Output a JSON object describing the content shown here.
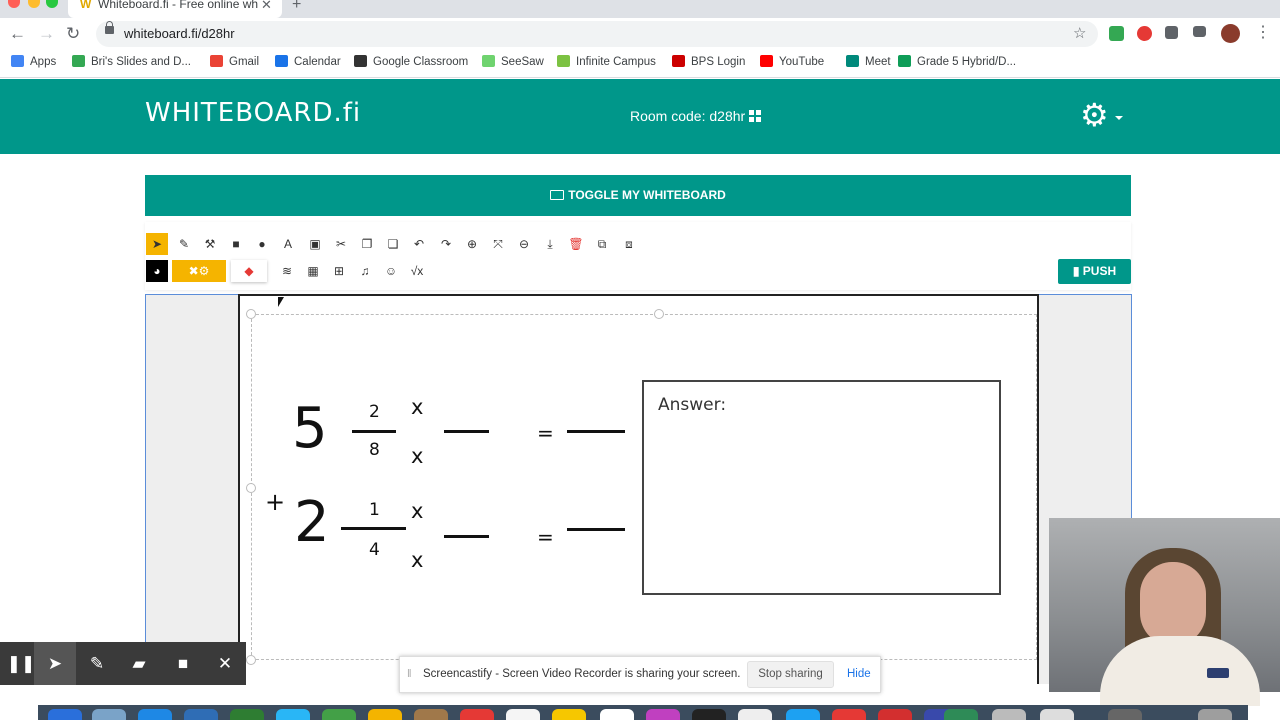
{
  "browser": {
    "tab_title": "Whiteboard.fi - Free online wh",
    "tab_favicon": "W",
    "close_glyph": "✕",
    "new_tab_glyph": "+",
    "back_glyph": "←",
    "forward_glyph": "→",
    "reload_glyph": "↻",
    "url": "whiteboard.fi/d28hr",
    "star_glyph": "☆",
    "menu_glyph": "⋮",
    "bookmarks": [
      {
        "label": "Apps",
        "icon": "apps-grid-icon",
        "color": "#4285f4"
      },
      {
        "label": "Bri's Slides and D...",
        "icon": "google-drive-icon",
        "color": "#34a853"
      },
      {
        "label": "Gmail",
        "icon": "gmail-icon",
        "color": "#ea4335"
      },
      {
        "label": "Calendar",
        "icon": "calendar-icon",
        "color": "#1a73e8"
      },
      {
        "label": "Google Classroom",
        "icon": "classroom-icon",
        "color": "#333333"
      },
      {
        "label": "SeeSaw",
        "icon": "seesaw-icon",
        "color": "#6fd36f"
      },
      {
        "label": "Infinite Campus",
        "icon": "infinite-campus-icon",
        "color": "#7cc242"
      },
      {
        "label": "BPS Login",
        "icon": "bps-icon",
        "color": "#cc0000"
      },
      {
        "label": "YouTube",
        "icon": "youtube-icon",
        "color": "#ff0000"
      },
      {
        "label": "Meet",
        "icon": "meet-icon",
        "color": "#00897b"
      },
      {
        "label": "Grade 5 Hybrid/D...",
        "icon": "sheets-icon",
        "color": "#0f9d58"
      }
    ]
  },
  "app": {
    "logo": "WHITEBOARD.fi",
    "room_code": "Room code: d28hr",
    "gear_glyph": "⚙",
    "toggle_label": "TOGGLE MY WHITEBOARD",
    "push_label": "PUSH",
    "accent_color": "#00978a",
    "highlight_color": "#f5b400"
  },
  "tools": {
    "row1": [
      {
        "icon": "select-arrow-icon",
        "glyph": "➤"
      },
      {
        "icon": "pencil-icon",
        "glyph": "✎"
      },
      {
        "icon": "magic-wand-icon",
        "glyph": "⚒"
      },
      {
        "icon": "rectangle-icon",
        "glyph": "■"
      },
      {
        "icon": "circle-icon",
        "glyph": "●"
      },
      {
        "icon": "text-icon",
        "glyph": "A"
      },
      {
        "icon": "image-icon",
        "glyph": "▣"
      },
      {
        "icon": "cut-icon",
        "glyph": "✂"
      },
      {
        "icon": "copy-icon",
        "glyph": "❐"
      },
      {
        "icon": "paste-icon",
        "glyph": "❏"
      },
      {
        "icon": "undo-icon",
        "glyph": "↶"
      },
      {
        "icon": "redo-icon",
        "glyph": "↷"
      },
      {
        "icon": "zoom-in-icon",
        "glyph": "⊕"
      },
      {
        "icon": "fit-screen-icon",
        "glyph": "⤧"
      },
      {
        "icon": "zoom-out-icon",
        "glyph": "⊖"
      },
      {
        "icon": "download-icon",
        "glyph": "⤓"
      },
      {
        "icon": "delete-icon",
        "glyph": "🗑"
      },
      {
        "icon": "bring-front-icon",
        "glyph": "⧉"
      },
      {
        "icon": "send-back-icon",
        "glyph": "⧈"
      }
    ],
    "row2": [
      {
        "icon": "palette-icon",
        "glyph": "◕"
      },
      {
        "icon": "tools-settings-icon",
        "glyph": "✖⚙"
      },
      {
        "icon": "eraser-icon",
        "glyph": "◆"
      },
      {
        "icon": "layers-icon",
        "glyph": "≋"
      },
      {
        "icon": "grid-icon",
        "glyph": "▦"
      },
      {
        "icon": "table-icon",
        "glyph": "⊞"
      },
      {
        "icon": "music-icon",
        "glyph": "♫"
      },
      {
        "icon": "emoji-icon",
        "glyph": "☺"
      },
      {
        "icon": "math-sqrt-icon",
        "glyph": "√x"
      }
    ]
  },
  "worksheet": {
    "row1": {
      "whole": "5",
      "numerator": "2",
      "denominator": "8",
      "mult_top": "x",
      "mult_bottom": "x",
      "equals": "="
    },
    "row2": {
      "operator": "+",
      "whole": "2",
      "numerator": "1",
      "denominator": "4",
      "mult_top": "x",
      "mult_bottom": "x",
      "equals": "="
    },
    "answer_label": "Answer:"
  },
  "screencastify": {
    "pause_glyph": "❚❚",
    "cursor_glyph": "➤",
    "pen_glyph": "✎",
    "highlighter_glyph": "▰",
    "camera_glyph": "■",
    "close_glyph": "✕",
    "grip_glyph": "‖",
    "share_text": "Screencastify - Screen Video Recorder is sharing your screen.",
    "stop_label": "Stop sharing",
    "hide_label": "Hide"
  }
}
